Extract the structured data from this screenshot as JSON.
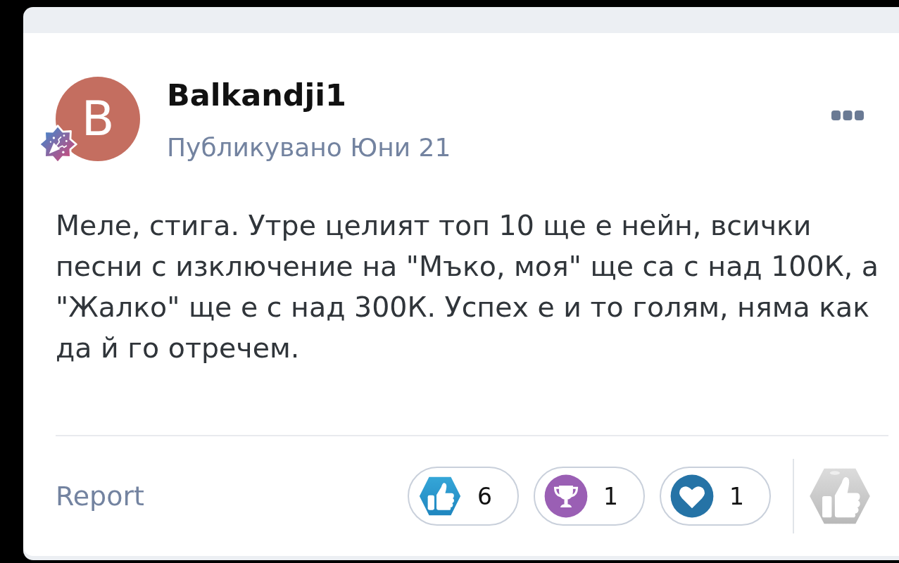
{
  "post": {
    "author": {
      "name": "Balkandji1",
      "avatar_letter": "B"
    },
    "posted": "Публикувано Юни 21",
    "body": "Меле, стига. Утре целият топ 10 ще е нейн, всички песни с изключение на \"Мъко, моя\" ще са с над 100К, а \"Жалко\" ще е с над 300К. Успех е и то голям, няма как да й го отречем.",
    "report": "Report",
    "reactions": [
      {
        "kind": "like",
        "count": "6"
      },
      {
        "kind": "trophy",
        "count": "1"
      },
      {
        "kind": "heart",
        "count": "1"
      }
    ]
  }
}
